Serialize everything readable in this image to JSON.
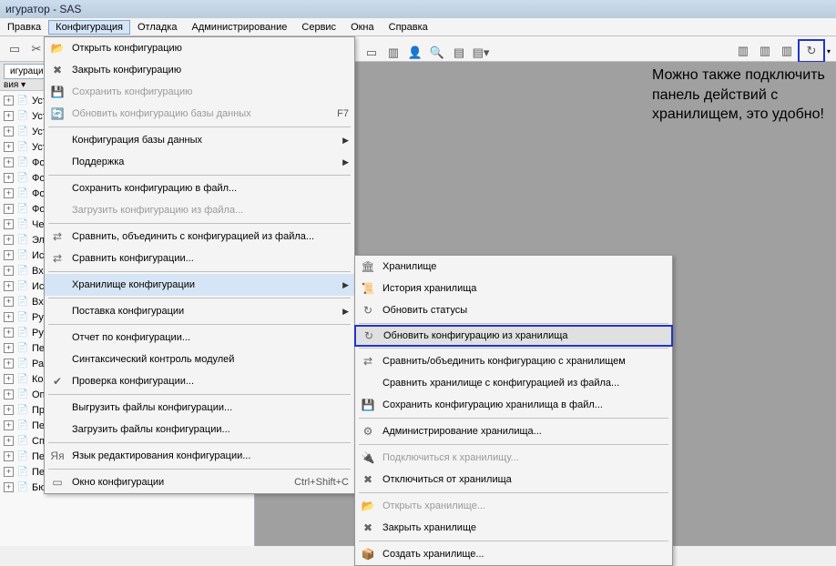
{
  "title": "игуратор - SAS",
  "menubar": [
    "Правка",
    "Конфигурация",
    "Отладка",
    "Администрирование",
    "Сервис",
    "Окна",
    "Справка"
  ],
  "menubar_active": 1,
  "sidebar": {
    "tab": "игураци",
    "sub": "вия ▾",
    "items": [
      {
        "label": "Уст",
        "lock": false
      },
      {
        "label": "Уст",
        "lock": false
      },
      {
        "label": "Уст",
        "lock": false
      },
      {
        "label": "Уст",
        "lock": false
      },
      {
        "label": "Фор",
        "lock": false
      },
      {
        "label": "Фор",
        "lock": false
      },
      {
        "label": "Фор",
        "lock": false
      },
      {
        "label": "Фор",
        "lock": false
      },
      {
        "label": "Чек",
        "lock": false
      },
      {
        "label": "Эле",
        "lock": false
      },
      {
        "label": "Исх",
        "lock": false
      },
      {
        "label": "Вхо",
        "lock": false
      },
      {
        "label": "Исх",
        "lock": false
      },
      {
        "label": "Вхо",
        "lock": false
      },
      {
        "label": "Руч",
        "lock": false
      },
      {
        "label": "Руч",
        "lock": false
      },
      {
        "label": "Пер",
        "lock": false
      },
      {
        "label": "Рас",
        "lock": false
      },
      {
        "label": "Кор",
        "lock": false
      },
      {
        "label": "Опе",
        "lock": false
      },
      {
        "label": "ПринятиеКУчетуОС",
        "lock": true
      },
      {
        "label": "ПеремещениеОС",
        "lock": true
      },
      {
        "label": "СписаниеОС",
        "lock": true
      },
      {
        "label": "ПередачаОС",
        "lock": true
      },
      {
        "label": "ПереоценкаОС",
        "lock": true
      },
      {
        "label": "БюджетДоходовИРасходов",
        "lock": true
      }
    ]
  },
  "dropdown": [
    {
      "icon": "📂",
      "label": "Открыть конфигурацию"
    },
    {
      "icon": "✖",
      "label": "Закрыть конфигурацию",
      "disabled": false
    },
    {
      "icon": "💾",
      "label": "Сохранить конфигурацию",
      "disabled": true
    },
    {
      "icon": "🔄",
      "label": "Обновить конфигурацию базы данных",
      "shortcut": "F7",
      "disabled": true
    },
    {
      "sep": true
    },
    {
      "label": "Конфигурация базы данных",
      "arrow": true
    },
    {
      "label": "Поддержка",
      "arrow": true
    },
    {
      "sep": true
    },
    {
      "label": "Сохранить конфигурацию в файл..."
    },
    {
      "label": "Загрузить конфигурацию из файла...",
      "disabled": true
    },
    {
      "sep": true
    },
    {
      "icon": "⇄",
      "label": "Сравнить, объединить с конфигурацией из файла..."
    },
    {
      "icon": "⇄",
      "label": "Сравнить конфигурации..."
    },
    {
      "sep": true
    },
    {
      "label": "Хранилище конфигурации",
      "arrow": true,
      "highlight": true
    },
    {
      "sep": true
    },
    {
      "label": "Поставка конфигурации",
      "arrow": true
    },
    {
      "sep": true
    },
    {
      "label": "Отчет по конфигурации..."
    },
    {
      "label": "Синтаксический контроль модулей"
    },
    {
      "icon": "✔",
      "label": "Проверка конфигурации..."
    },
    {
      "sep": true
    },
    {
      "label": "Выгрузить файлы конфигурации..."
    },
    {
      "label": "Загрузить файлы конфигурации..."
    },
    {
      "sep": true
    },
    {
      "icon": "Яя",
      "label": "Язык редактирования конфигурации..."
    },
    {
      "sep": true
    },
    {
      "icon": "▭",
      "label": "Окно конфигурации",
      "shortcut": "Ctrl+Shift+C"
    }
  ],
  "submenu": [
    {
      "icon": "🏛",
      "label": "Хранилище"
    },
    {
      "icon": "📜",
      "label": "История хранилища"
    },
    {
      "icon": "↻",
      "label": "Обновить статусы"
    },
    {
      "sep": true
    },
    {
      "icon": "↻",
      "label": "Обновить конфигурацию из хранилища",
      "hl": true
    },
    {
      "sep": true
    },
    {
      "icon": "⇄",
      "label": "Сравнить/объединить конфигурацию с хранилищем"
    },
    {
      "label": "Сравнить хранилище с конфигурацией из файла..."
    },
    {
      "icon": "💾",
      "label": "Сохранить конфигурацию хранилища в файл..."
    },
    {
      "sep": true
    },
    {
      "icon": "⚙",
      "label": "Администрирование хранилища..."
    },
    {
      "sep": true
    },
    {
      "icon": "🔌",
      "label": "Подключиться к хранилищу...",
      "disabled": true
    },
    {
      "icon": "✖",
      "label": "Отключиться от хранилища"
    },
    {
      "sep": true
    },
    {
      "icon": "📂",
      "label": "Открыть хранилище...",
      "disabled": true
    },
    {
      "icon": "✖",
      "label": "Закрыть хранилище"
    },
    {
      "sep": true
    },
    {
      "icon": "📦",
      "label": "Создать хранилище..."
    }
  ],
  "annotation": "Можно также подключить панель действий с хранилищем, это удобно!"
}
